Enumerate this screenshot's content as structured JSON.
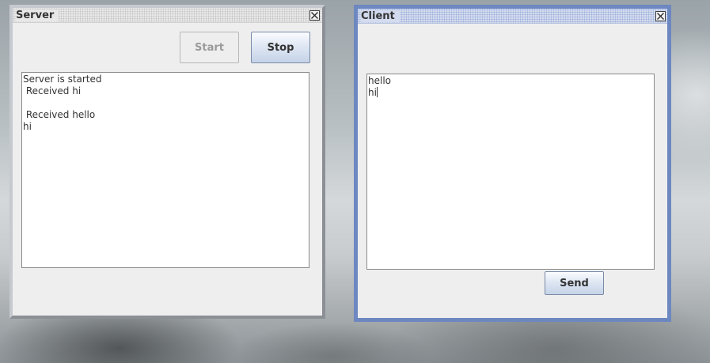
{
  "server_window": {
    "title": "Server",
    "start_label": "Start",
    "stop_label": "Stop",
    "log_text": "Server is started\n Received hi\n\n Received hello\nhi"
  },
  "client_window": {
    "title": "Client",
    "message_text": "hello\nhi",
    "send_label": "Send"
  },
  "icons": {
    "close": "close-icon"
  },
  "colors": {
    "client_frame": "#6d87c0",
    "button_gradient_end": "#c5d3e8",
    "disabled_text": "#9a9a9a"
  }
}
